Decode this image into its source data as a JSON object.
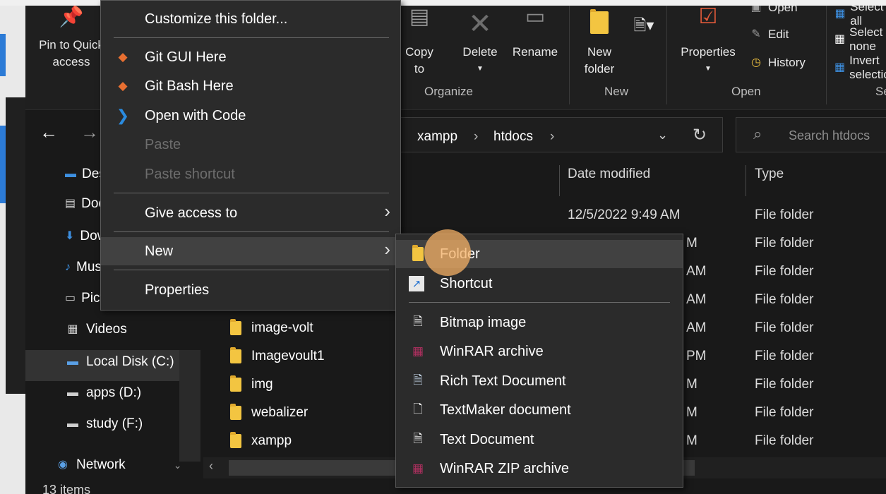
{
  "ribbon": {
    "pin": "Pin to Quick access",
    "copy_to": "Copy to",
    "delete": "Delete",
    "rename": "Rename",
    "new_folder": "New folder",
    "properties": "Properties",
    "open_small": "Open",
    "edit": "Edit",
    "history": "History",
    "select_all": "Select all",
    "select_none": "Select none",
    "invert": "Invert selection",
    "groups": {
      "organize": "Organize",
      "new": "New",
      "open": "Open",
      "select": "Select"
    }
  },
  "address": {
    "crumbs": [
      "xampp",
      "htdocs"
    ],
    "search_placeholder": "Search htdocs"
  },
  "nav": {
    "items": [
      {
        "label": "Desktop",
        "icon": "desktop-icon"
      },
      {
        "label": "Documents",
        "icon": "documents-icon"
      },
      {
        "label": "Downloads",
        "icon": "downloads-icon"
      },
      {
        "label": "Music",
        "icon": "music-icon"
      },
      {
        "label": "Pictures",
        "icon": "pictures-icon"
      },
      {
        "label": "Videos",
        "icon": "videos-icon"
      },
      {
        "label": "Local Disk (C:)",
        "icon": "local-disk-icon"
      },
      {
        "label": "apps (D:)",
        "icon": "drive-icon"
      },
      {
        "label": "study (F:)",
        "icon": "drive-icon"
      },
      {
        "label": "Network",
        "icon": "network-icon"
      }
    ]
  },
  "columns": {
    "date": "Date modified",
    "type": "Type"
  },
  "files": [
    {
      "name": "",
      "date": "12/5/2022 9:49 AM",
      "type": "File folder"
    },
    {
      "name": "",
      "date": "M",
      "type": "File folder"
    },
    {
      "name": "",
      "date": "AM",
      "type": "File folder"
    },
    {
      "name": "",
      "date": "AM",
      "type": "File folder"
    },
    {
      "name": "image-volt",
      "date": "AM",
      "type": "File folder"
    },
    {
      "name": "Imagevoult1",
      "date": "PM",
      "type": "File folder"
    },
    {
      "name": "img",
      "date": "M",
      "type": "File folder"
    },
    {
      "name": "webalizer",
      "date": "M",
      "type": "File folder"
    },
    {
      "name": "xampp",
      "date": "M",
      "type": "File folder"
    }
  ],
  "status": "13 items",
  "context_menu": {
    "customize": "Customize this folder...",
    "git_gui": "Git GUI Here",
    "git_bash": "Git Bash Here",
    "open_code": "Open with Code",
    "paste": "Paste",
    "paste_shortcut": "Paste shortcut",
    "give_access": "Give access to",
    "new": "New",
    "properties": "Properties"
  },
  "submenu": {
    "folder": "Folder",
    "shortcut": "Shortcut",
    "bitmap": "Bitmap image",
    "winrar": "WinRAR archive",
    "rtf": "Rich Text Document",
    "textmaker": "TextMaker document",
    "text": "Text Document",
    "winrar_zip": "WinRAR ZIP archive"
  }
}
